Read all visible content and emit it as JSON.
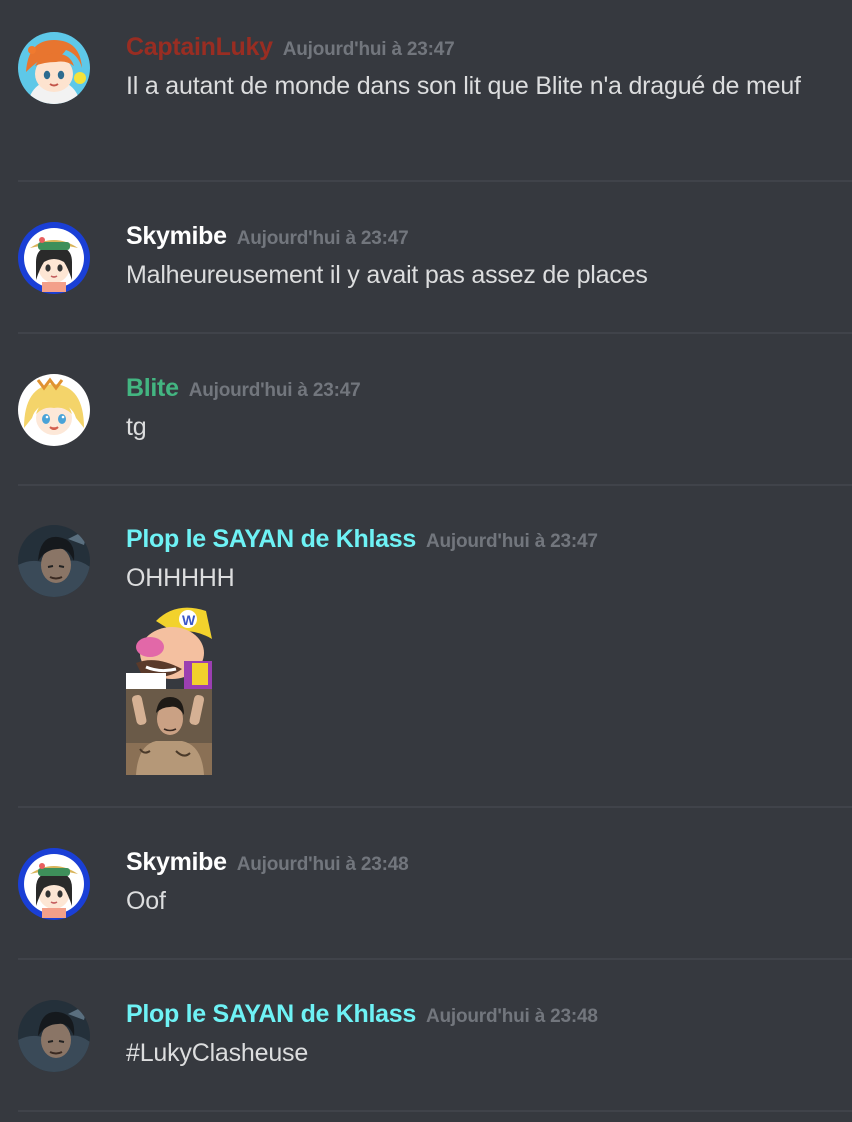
{
  "messages": [
    {
      "username": "CaptainLuky",
      "username_color": "#992d22",
      "timestamp": "Aujourd'hui à 23:47",
      "text": "Il a autant de monde dans son lit que Blite n'a dragué de meuf",
      "avatar": "anime-girl-orange-hair-avatar"
    },
    {
      "username": "Skymibe",
      "username_color": "#ffffff",
      "timestamp": "Aujourd'hui à 23:47",
      "text": "Malheureusement il y avait pas assez de places",
      "avatar": "anime-girl-straw-hat-avatar"
    },
    {
      "username": "Blite",
      "username_color": "#43b581",
      "timestamp": "Aujourd'hui à 23:47",
      "text": "tg",
      "avatar": "anime-girl-blonde-avatar"
    },
    {
      "username": "Plop le SAYAN de Khlass",
      "username_color": "#6ef2f5",
      "timestamp": "Aujourd'hui à 23:47",
      "text": "OHHHHH",
      "avatar": "dark-haired-warrior-avatar",
      "emojis": [
        "wario-emoji",
        "praising-man-emoji"
      ]
    },
    {
      "username": "Skymibe",
      "username_color": "#ffffff",
      "timestamp": "Aujourd'hui à 23:48",
      "text": "Oof",
      "avatar": "anime-girl-straw-hat-avatar"
    },
    {
      "username": "Plop le SAYAN de Khlass",
      "username_color": "#6ef2f5",
      "timestamp": "Aujourd'hui à 23:48",
      "text": "#LukyClasheuse",
      "avatar": "dark-haired-warrior-avatar"
    }
  ]
}
